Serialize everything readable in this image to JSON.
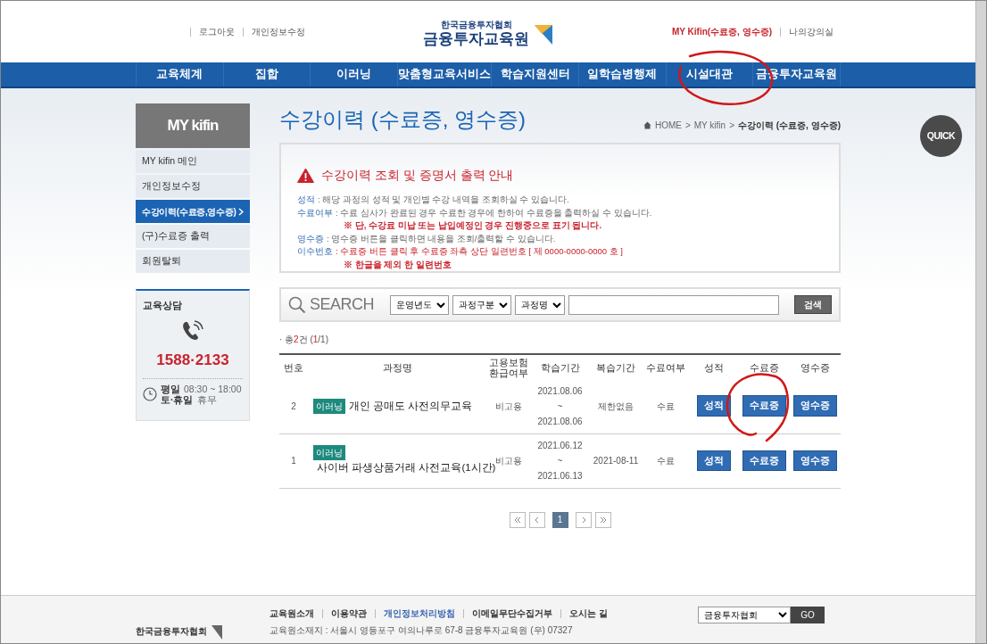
{
  "header": {
    "logout": "로그아웃",
    "edit_profile": "개인정보수정",
    "logo_org": "한국금융투자협회",
    "logo_name": "금융투자교육원",
    "my_kifin": "MY Kifin(수료증, 영수증)",
    "my_classroom": "나의강의실"
  },
  "nav": [
    {
      "label": "교육체계"
    },
    {
      "label": "집합"
    },
    {
      "label": "이러닝"
    },
    {
      "label": "맞춤형교육서비스"
    },
    {
      "label": "학습지원센터"
    },
    {
      "label": "일학습병행제"
    },
    {
      "label": "시설대관"
    },
    {
      "label": "금융투자교육원"
    }
  ],
  "sidebar": {
    "title": "MY kifin",
    "items": [
      {
        "label": "MY kifin 메인",
        "selected": false
      },
      {
        "label": "개인정보수정",
        "selected": false
      },
      {
        "label": "수강이력(수료증,영수증)",
        "selected": true
      },
      {
        "label": "(구)수료증 출력",
        "selected": false
      },
      {
        "label": "회원탈퇴",
        "selected": false
      }
    ]
  },
  "consult": {
    "title": "교육상담",
    "phone": "1588·2133",
    "hours": [
      {
        "day": "평일",
        "time": "08:30 ~ 18:00"
      },
      {
        "day": "토·휴일",
        "time": "휴무"
      }
    ]
  },
  "page_title": "수강이력 (수료증, 영수증)",
  "breadcrumb": [
    {
      "label": "HOME"
    },
    {
      "label": ">"
    },
    {
      "label": "MY kifin"
    },
    {
      "label": ">"
    },
    {
      "label": "수강이력 (수료증, 영수증)"
    }
  ],
  "quick": "QUICK",
  "notice": {
    "title": "수강이력 조회 및 증명서 출력 안내",
    "lines": [
      {
        "kind": "item",
        "term": "성적",
        "text": ": 해당 과정의 성적 및 개인별 수강 내역을 조회하실 수 있습니다.",
        "alert": false
      },
      {
        "kind": "item",
        "term": "수료여부",
        "text": ": 수료 심사가 완료된 경우 수료한 경우에 한하여 수료증을 출력하실 수 있습니다.",
        "alert": false
      },
      {
        "kind": "note",
        "text": "※ 단, 수강료 미납 또는 납입예정인 경우 진행중으로 표기 됩니다."
      },
      {
        "kind": "item",
        "term": "영수증",
        "text": ": 영수증 버튼을 클릭하면 내용을 조회/출력할 수 있습니다.",
        "alert": false
      },
      {
        "kind": "item",
        "term": "이수번호",
        "text": ": 수료증 버튼 클릭 후 수료증 좌측 상단 일련번호 [ 제 0000-0000-0000 호 ]",
        "alert": true
      },
      {
        "kind": "note",
        "text": "※ 한글을 제외 한 일련번호"
      }
    ]
  },
  "search": {
    "label": "SEARCH",
    "selects": [
      "운영년도",
      "과정구분",
      "과정명"
    ],
    "button": "검색"
  },
  "total": {
    "bullet": "·",
    "label": "총",
    "count": "2",
    "unit": "건",
    "open": "(",
    "page": "1",
    "rest": "/1)"
  },
  "table": {
    "columns": [
      "번호",
      "과정명",
      "고용보험 환급여부",
      "학습기간",
      "복습기간",
      "수료여부",
      "성적",
      "수료증",
      "영수증"
    ],
    "rows": [
      {
        "no": "2",
        "tag": "이러닝",
        "title": "개인 공매도 사전의무교육",
        "insurance": "비고용",
        "start": "2021.08.06",
        "sep": "~",
        "end": "2021.08.06",
        "review": "제한없음",
        "status": "수료",
        "buttons": [
          "성적",
          "수료증",
          "영수증"
        ]
      },
      {
        "no": "1",
        "tag": "이러닝",
        "title": "사이버 파생상품거래 사전교육(1시간)",
        "insurance": "비고용",
        "start": "2021.06.12",
        "sep": "~",
        "end": "2021.06.13",
        "review": "2021-08-11",
        "status": "수료",
        "buttons": [
          "성적",
          "수료증",
          "영수증"
        ]
      }
    ]
  },
  "pagination": {
    "pages": [
      {
        "label": "1",
        "selected": true
      }
    ]
  },
  "footer": {
    "links": [
      {
        "label": "교육원소개",
        "highlighted": false
      },
      {
        "label": "이용약관",
        "highlighted": false
      },
      {
        "label": "개인정보처리방침",
        "highlighted": true
      },
      {
        "label": "이메일무단수집거부",
        "highlighted": false
      },
      {
        "label": "오시는 길",
        "highlighted": false
      }
    ],
    "address": "교육원소재지 : 서울시 영등포구 여의나루로 67-8 금융투자교육원 (우) 07327",
    "logo_org": "한국금융투자협회",
    "family_select": "금융투자협회",
    "go": "GO"
  }
}
